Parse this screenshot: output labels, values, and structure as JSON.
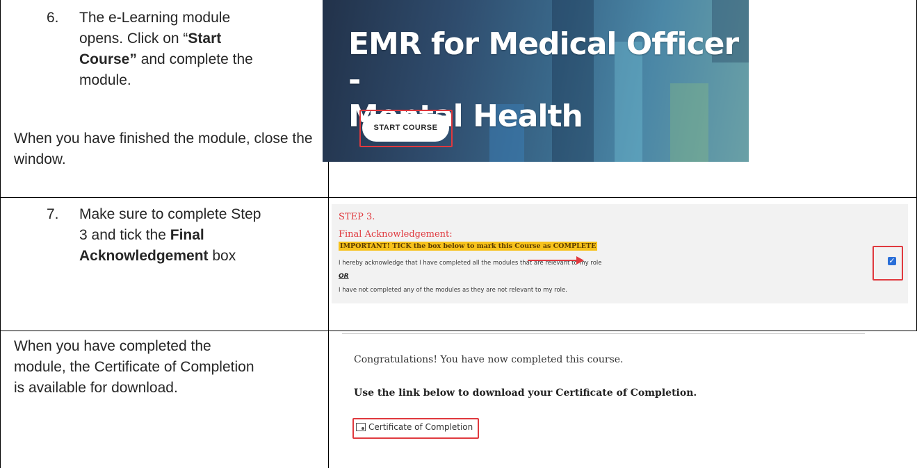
{
  "rows": [
    {
      "num": "6.",
      "lines_html": [
        "The e-Learning module",
        "opens. Click on “",
        "Start",
        "Course”",
        " and complete the",
        "module."
      ],
      "sub": "When you have finished the module, close the window."
    },
    {
      "num": "7.",
      "l1": "Make sure to complete Step",
      "l2a": "3 and tick the ",
      "l2b": "Final",
      "l3a": "Acknowledgement",
      "l3b": " box"
    },
    {
      "l1": "When you have completed the",
      "l2": "module, the Certificate of Completion",
      "l3": "is available for download."
    }
  ],
  "banner": {
    "title1": "EMR for Medical Officer -",
    "title2": "Mental Health",
    "button": "START COURSE"
  },
  "ack": {
    "step": "STEP 3.",
    "title": "Final Acknowledgement:",
    "important": "IMPORTANT! TICK the box below to mark this Course as COMPLETE",
    "line1": "I hereby acknowledge that I have completed all the modules that are relevant to my role",
    "or": "OR",
    "line2": "I have not completed any of the modules as they are not relevant to my role.",
    "check": "✓"
  },
  "completion": {
    "congrats": "Congratulations! You have now completed this course.",
    "use_link": "Use the link below to download your Certificate of Completion.",
    "cert": "Certificate of Completion"
  },
  "colors": {
    "accent_red": "#e0393e",
    "highlight": "#f7c21b",
    "check_blue": "#2a6fd8"
  }
}
